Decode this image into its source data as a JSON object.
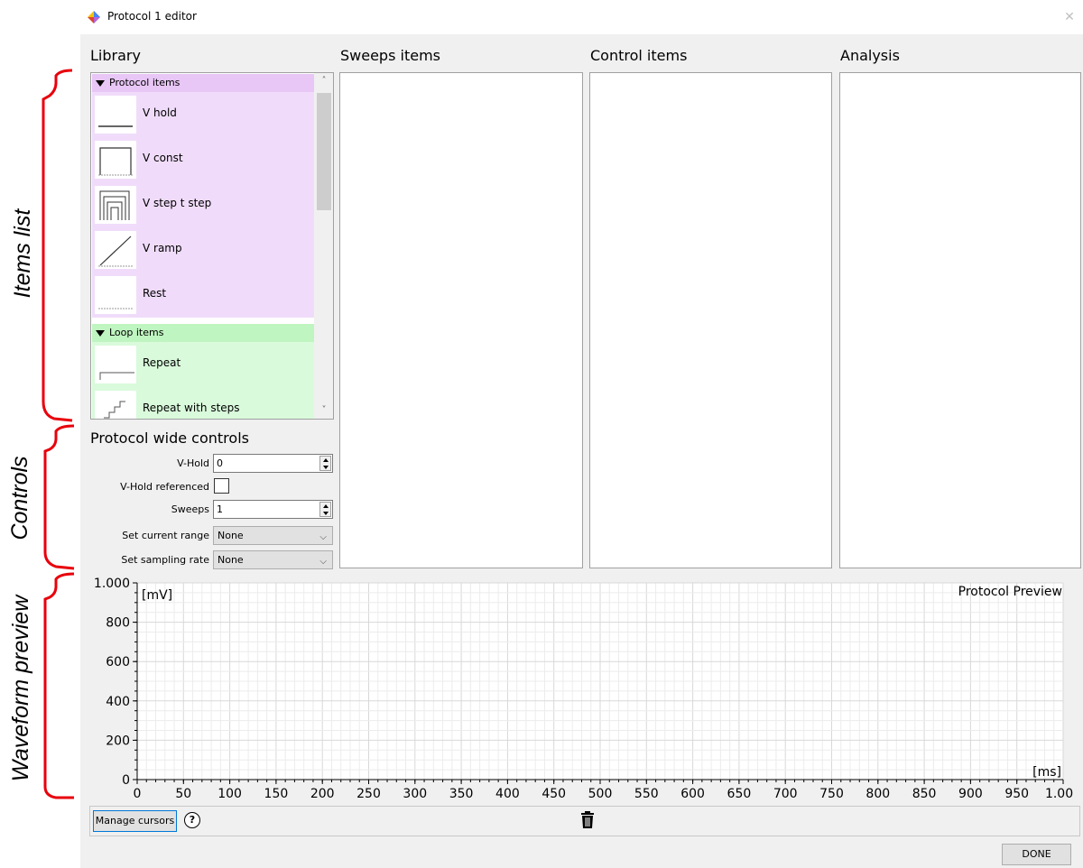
{
  "window": {
    "title": "Protocol 1 editor",
    "close_glyph": "✕"
  },
  "columns": {
    "library": "Library",
    "sweeps": "Sweeps items",
    "control": "Control items",
    "analysis": "Analysis"
  },
  "library": {
    "sections": [
      {
        "title": "Protocol items",
        "color": "#e8c6f5",
        "item_color": "#f0dcfa",
        "items": [
          {
            "label": "V hold",
            "icon": "v-hold-icon"
          },
          {
            "label": "V const",
            "icon": "v-const-icon"
          },
          {
            "label": "V step t step",
            "icon": "v-step-icon"
          },
          {
            "label": "V ramp",
            "icon": "v-ramp-icon"
          },
          {
            "label": "Rest",
            "icon": "rest-icon"
          }
        ]
      },
      {
        "title": "Loop items",
        "color": "#bff5c0",
        "item_color": "#d9fadb",
        "items": [
          {
            "label": "Repeat",
            "icon": "repeat-icon"
          },
          {
            "label": "Repeat with steps",
            "icon": "repeat-steps-icon"
          }
        ]
      }
    ]
  },
  "controls": {
    "heading": "Protocol wide controls",
    "vhold_label": "V-Hold",
    "vhold_value": "0",
    "vhold_ref_label": "V-Hold referenced",
    "vhold_ref_checked": false,
    "sweeps_label": "Sweeps",
    "sweeps_value": "1",
    "current_range_label": "Set current range",
    "current_range_value": "None",
    "sampling_rate_label": "Set sampling rate",
    "sampling_rate_value": "None"
  },
  "chart_data": {
    "type": "line",
    "title": "Protocol Preview",
    "ylabel": "[mV]",
    "xlabel": "[ms]",
    "ylim": [
      0,
      1000
    ],
    "xlim": [
      0,
      1000
    ],
    "y_ticks": [
      "0",
      "200",
      "400",
      "600",
      "800",
      "1.000"
    ],
    "x_ticks": [
      "0",
      "50",
      "100",
      "150",
      "200",
      "250",
      "300",
      "350",
      "400",
      "450",
      "500",
      "550",
      "600",
      "650",
      "700",
      "750",
      "800",
      "850",
      "900",
      "950",
      "1.000"
    ],
    "series": [],
    "grid": true
  },
  "bottom": {
    "manage_cursors": "Manage cursors",
    "help_glyph": "?",
    "done": "DONE"
  },
  "annotations": {
    "items_list": "Items list",
    "controls": "Controls",
    "waveform": "Waveform preview",
    "bracket_color": "#e8000b"
  }
}
